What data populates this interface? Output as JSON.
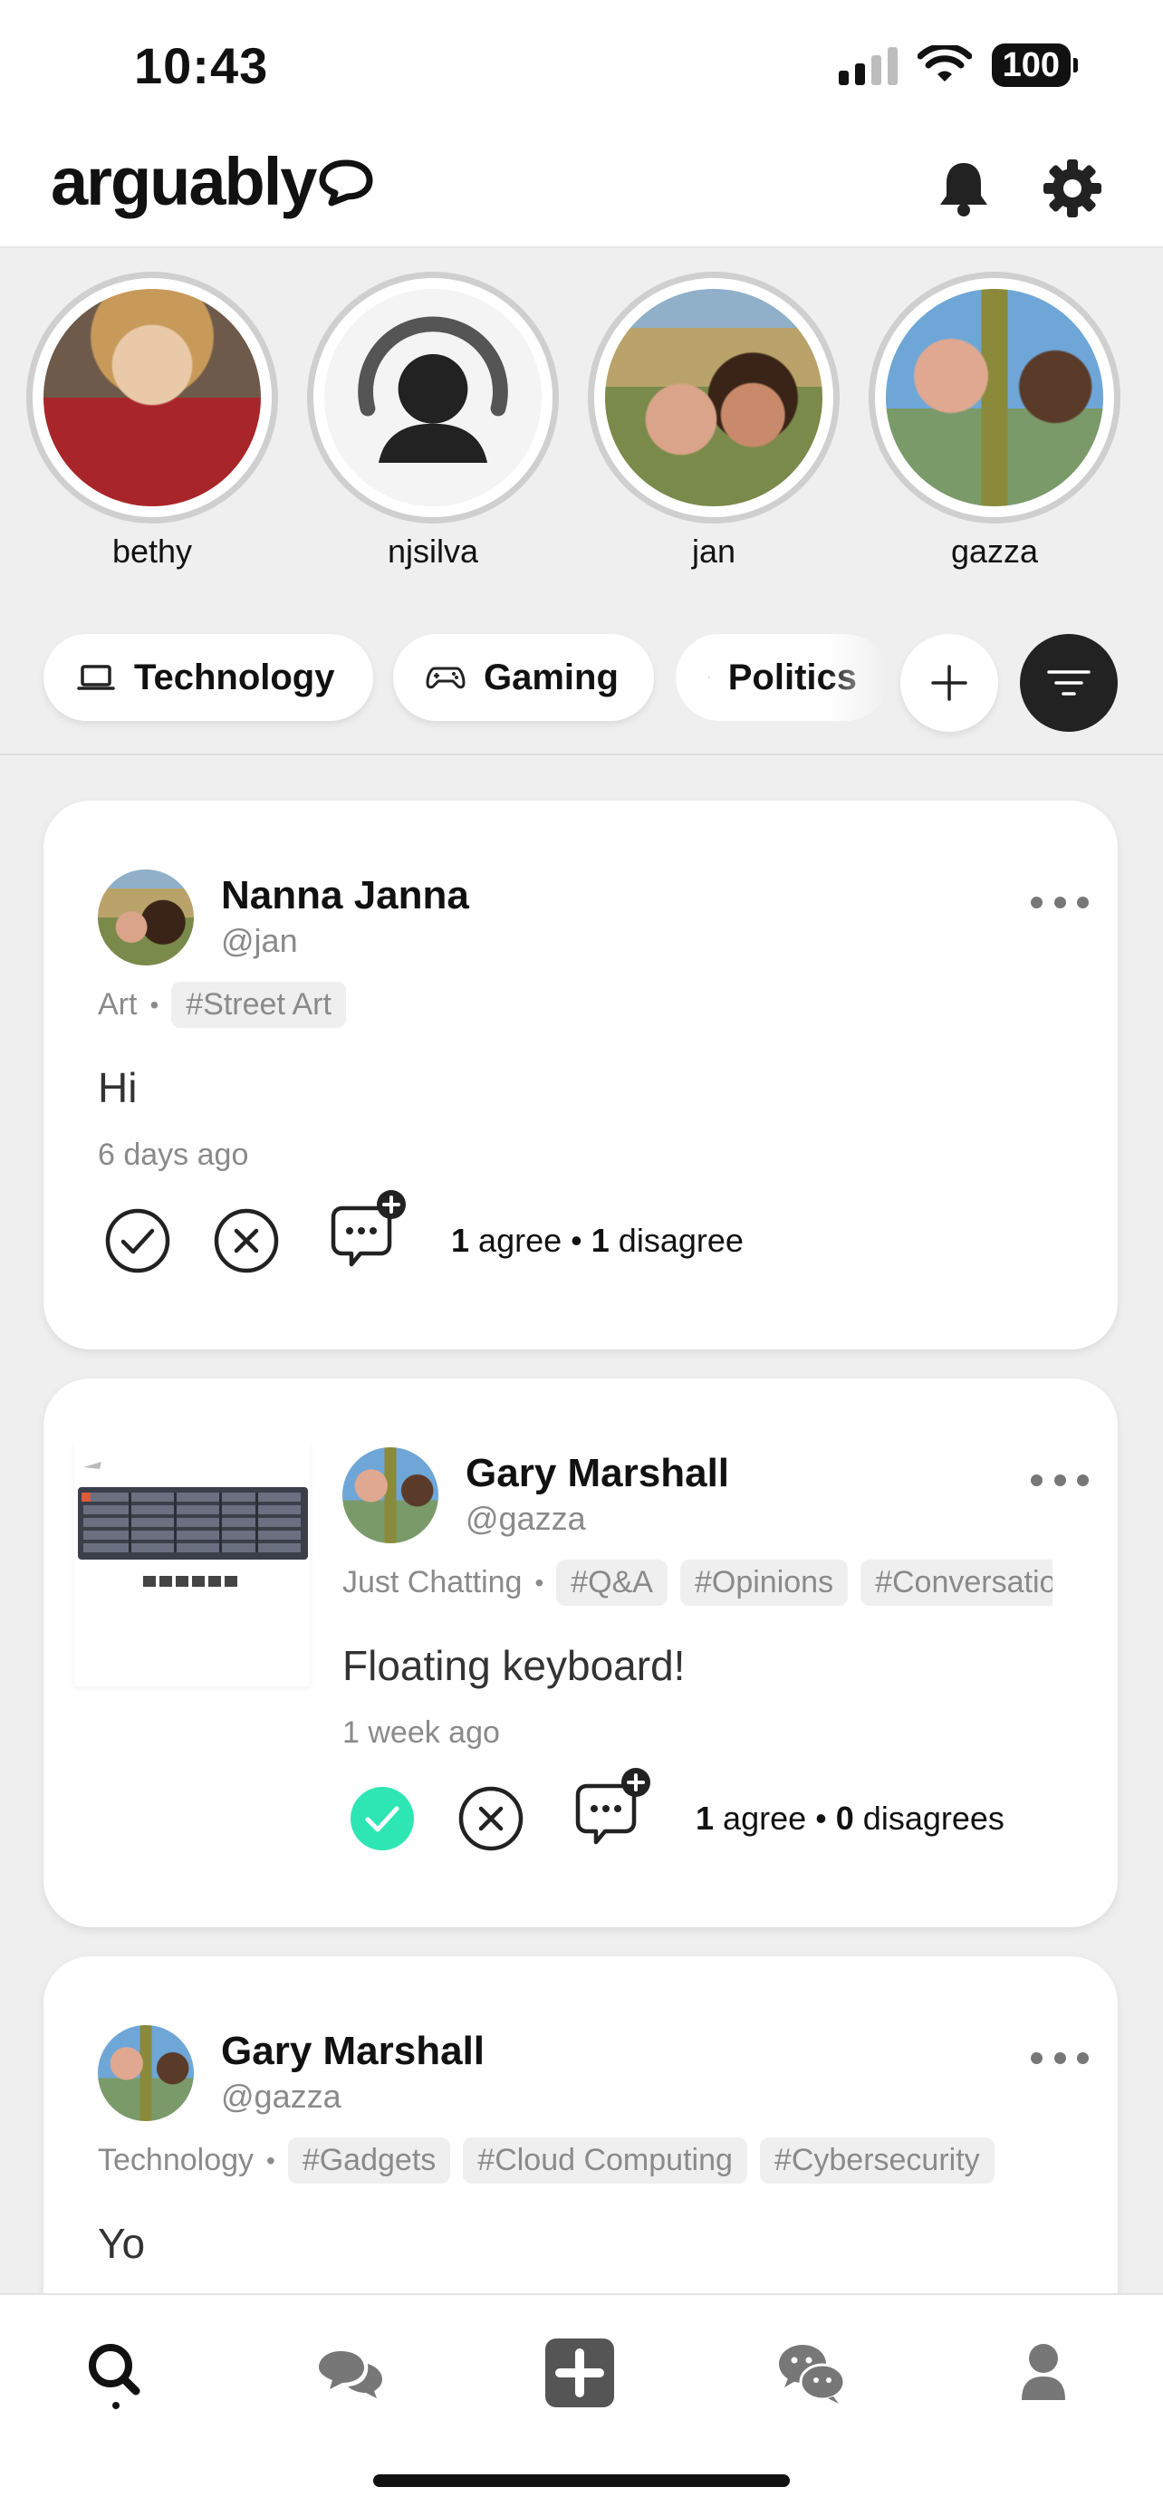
{
  "status_bar": {
    "time": "10:43",
    "battery": "100"
  },
  "header": {
    "logo": "arguably"
  },
  "stories": [
    {
      "name": "bethy"
    },
    {
      "name": "njsilva"
    },
    {
      "name": "jan"
    },
    {
      "name": "gazza"
    }
  ],
  "categories": [
    {
      "label": "Technology",
      "icon": "laptop-icon"
    },
    {
      "label": "Gaming",
      "icon": "gamepad-icon"
    },
    {
      "label": "Politics",
      "icon": "flag-icon"
    }
  ],
  "posts": [
    {
      "name": "Nanna Janna",
      "handle": "@jan",
      "category": "Art",
      "tags": [
        "#Street Art"
      ],
      "text": "Hi",
      "time": "6 days ago",
      "agree_count": "1",
      "agree_label": "agree",
      "disagree_count": "1",
      "disagree_label": "disagree",
      "agreed": false
    },
    {
      "name": "Gary Marshall",
      "handle": "@gazza",
      "category": "Just Chatting",
      "tags": [
        "#Q&A",
        "#Opinions",
        "#Conversation"
      ],
      "text": "Floating keyboard!",
      "time": "1 week ago",
      "agree_count": "1",
      "agree_label": "agree",
      "disagree_count": "0",
      "disagree_label": "disagrees",
      "agreed": true
    },
    {
      "name": "Gary Marshall",
      "handle": "@gazza",
      "category": "Technology",
      "tags": [
        "#Gadgets",
        "#Cloud Computing",
        "#Cybersecurity"
      ],
      "text": "Yo"
    }
  ],
  "colors": {
    "accent_green": "#2ee6b4",
    "dark": "#222222",
    "muted": "#8a8a8a"
  },
  "bottom_nav": [
    "search-icon",
    "chat-bubbles-icon",
    "plus-square-icon",
    "wechat-icon",
    "profile-icon"
  ]
}
